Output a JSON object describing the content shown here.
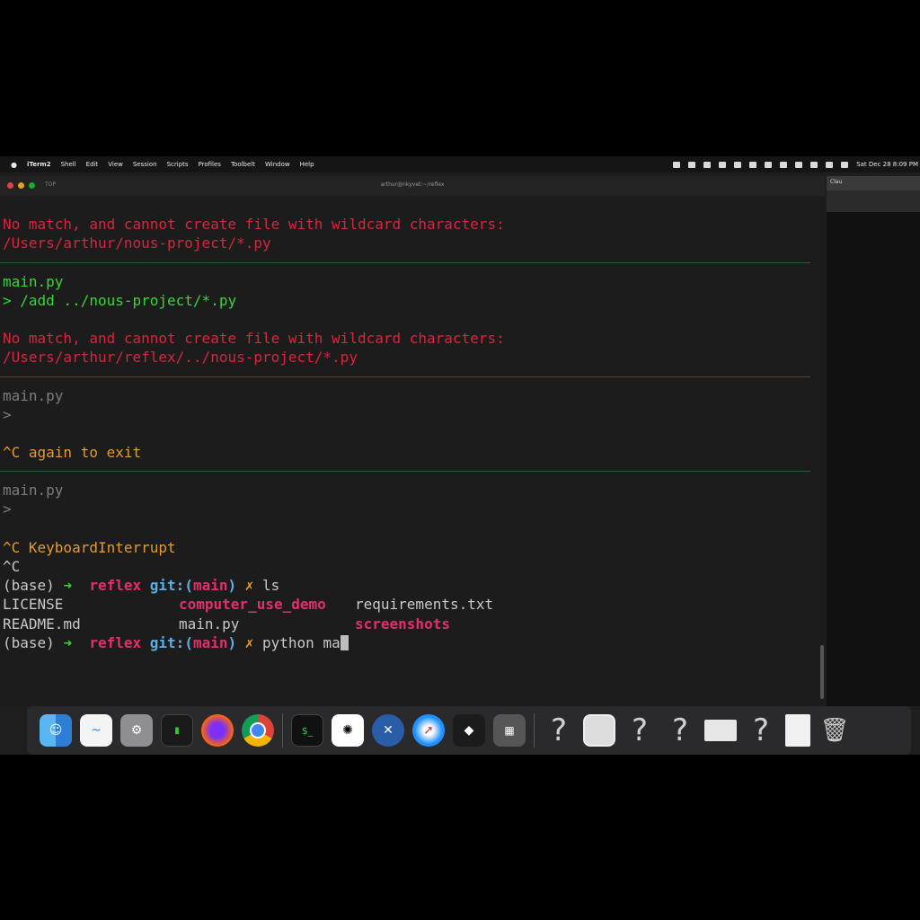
{
  "menubar": {
    "apple": "",
    "items": [
      "iTerm2",
      "Shell",
      "Edit",
      "View",
      "Session",
      "Scripts",
      "Profiles",
      "Toolbelt",
      "Window",
      "Help"
    ],
    "clock": "Sat Dec 28 8:09 PM"
  },
  "window": {
    "tab_name": "TOP",
    "title": "arthur@nkyvet:~/reflex"
  },
  "side_window": {
    "tab": "Clau"
  },
  "terminal": {
    "err1_a": "No match, and cannot create file with wildcard characters:",
    "err1_b": "/Users/arthur/nous-project/*.py",
    "file1": "main.py",
    "cmd_add": "> /add ../nous-project/*.py",
    "err2_a": "No match, and cannot create file with wildcard characters:",
    "err2_b": "/Users/arthur/reflex/../nous-project/*.py",
    "file2": "main.py",
    "prompt2": ">",
    "ctrlc_msg": "^C again to exit",
    "file3": "main.py",
    "prompt3": ">",
    "interrupt": "^C KeyboardInterrupt",
    "ctrlc": "^C",
    "sh1": {
      "env": "(base) ",
      "arrow": "➜  ",
      "dir": "reflex ",
      "git": "git:(",
      "branch": "main",
      "gitc": ") ",
      "x": "✗ ",
      "cmd": "ls"
    },
    "ls_row1": {
      "a": "LICENSE",
      "b": "computer_use_demo",
      "c": "requirements.txt"
    },
    "ls_row2": {
      "a": "README.md",
      "b": "main.py",
      "c": "screenshots"
    },
    "sh2": {
      "env": "(base) ",
      "arrow": "➜  ",
      "dir": "reflex ",
      "git": "git:(",
      "branch": "main",
      "gitc": ") ",
      "x": "✗ ",
      "cmd": "python ma"
    }
  },
  "dock": {
    "apps": [
      "finder",
      "freeform",
      "system-settings",
      "activity-monitor",
      "firefox",
      "chrome",
      "terminal",
      "chatgpt",
      "xcode-instruments",
      "safari",
      "cursor",
      "calculator",
      "unknown-1",
      "preview-image",
      "unknown-2",
      "unknown-3",
      "window-thumbnail",
      "unknown-4",
      "document",
      "trash"
    ],
    "question": "?"
  }
}
